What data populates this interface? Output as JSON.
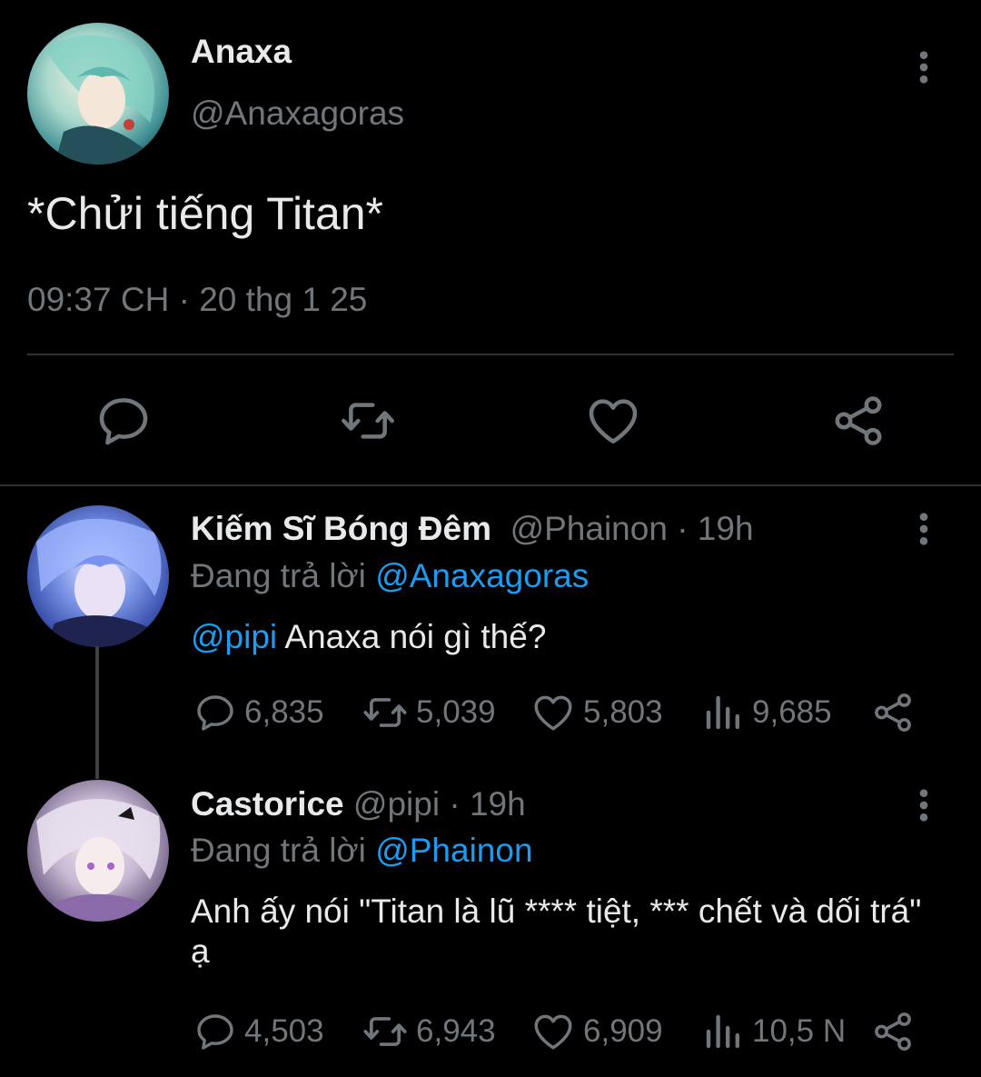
{
  "main_tweet": {
    "author_name": "Anaxa",
    "author_handle": "@Anaxagoras",
    "text": "*Chửi tiếng Titan*",
    "timestamp": "09:37 CH · 20 thg 1 25",
    "actions": [
      "reply-icon",
      "retweet-icon",
      "like-icon",
      "share-icon"
    ]
  },
  "replies": [
    {
      "author_name": "Kiếm Sĩ Bóng Đêm",
      "meta": "@Phainon · 19h",
      "replying_prefix": "Đang trả lời ",
      "replying_to": "@Anaxagoras",
      "mention": "@pipi",
      "text": " Anaxa nói gì thế?",
      "stats": {
        "replies": "6,835",
        "retweets": "5,039",
        "likes": "5,803",
        "views": "9,685"
      }
    },
    {
      "author_name": "Castorice",
      "meta": "@pipi · 19h",
      "replying_prefix": "Đang trả lời ",
      "replying_to": "@Phainon",
      "text": "Anh ấy nói \"Titan là lũ **** tiệt, *** chết và dối trá\" ạ",
      "stats": {
        "replies": "4,503",
        "retweets": "6,943",
        "likes": "6,909",
        "views": "10,5 N"
      }
    }
  ],
  "colors": {
    "background": "#000000",
    "primary_text": "#e7e9ea",
    "secondary_text": "#71767b",
    "link": "#1d9bf0",
    "divider": "#2f3336"
  }
}
